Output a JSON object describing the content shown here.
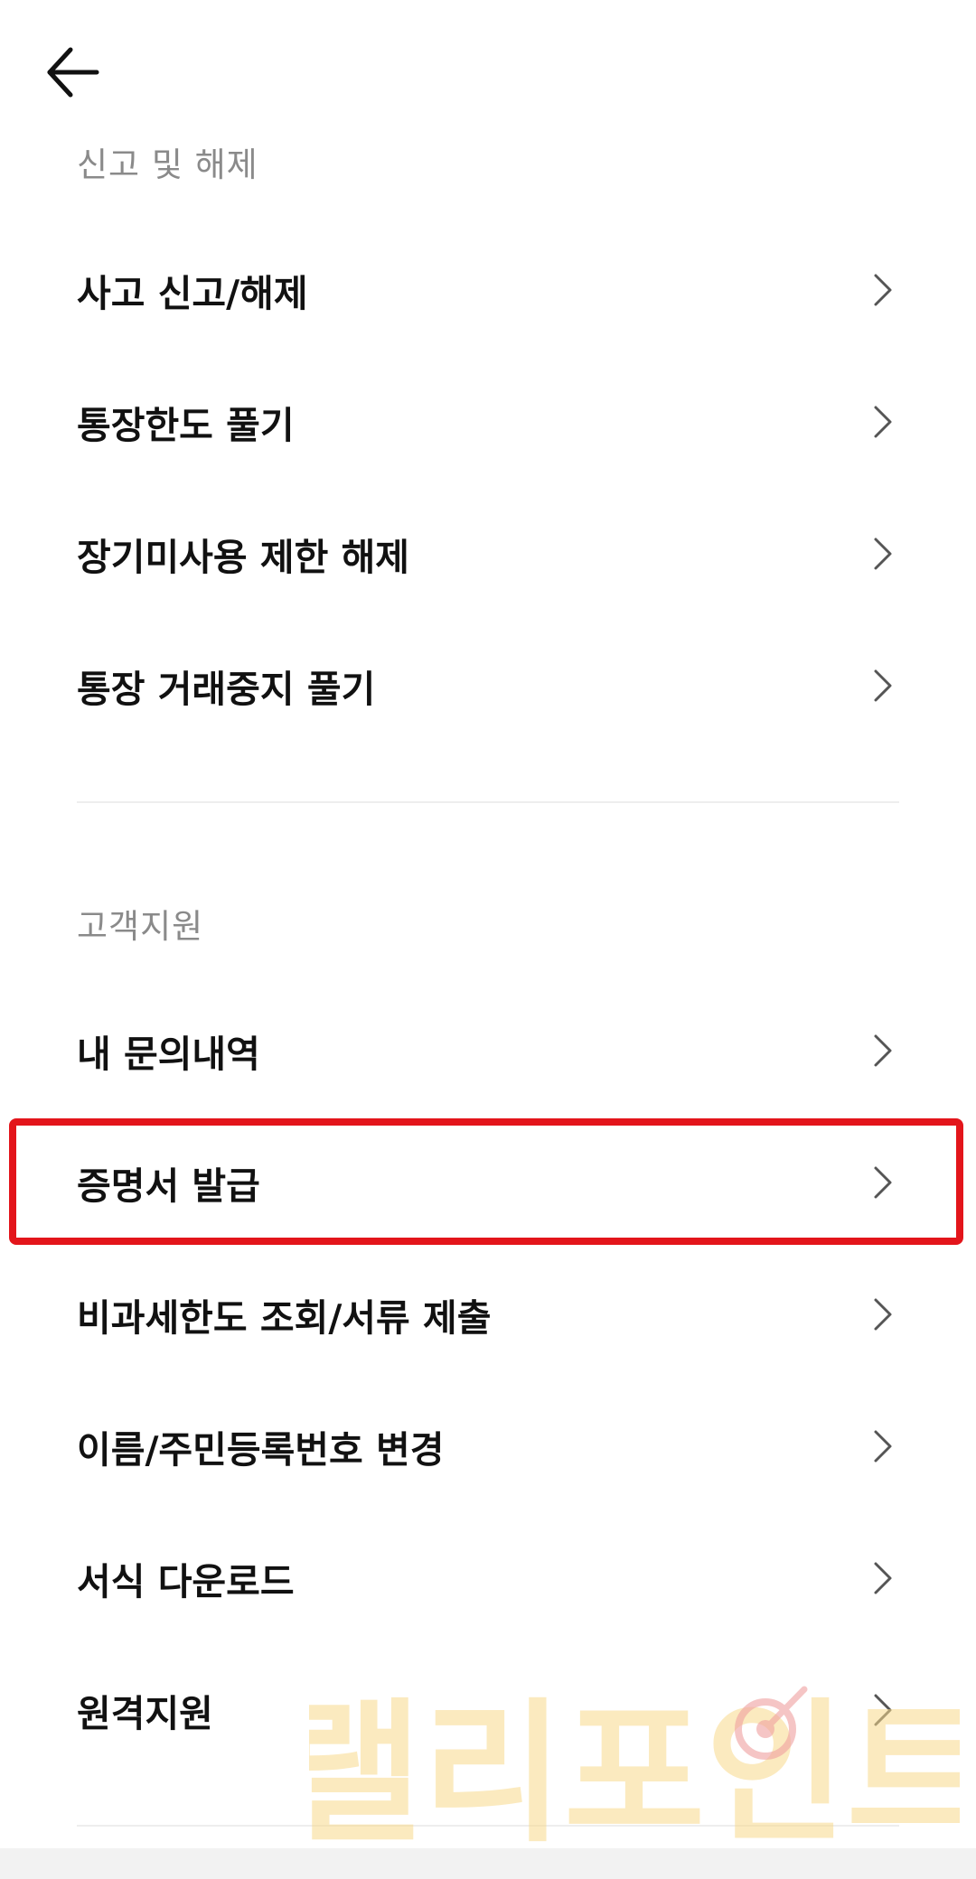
{
  "header": {
    "back_icon": "arrow-left-icon"
  },
  "sections": [
    {
      "title": "신고 및 해제",
      "items": [
        {
          "label": "사고 신고/해제"
        },
        {
          "label": "통장한도 풀기"
        },
        {
          "label": "장기미사용 제한 해제"
        },
        {
          "label": "통장 거래중지 풀기"
        }
      ]
    },
    {
      "title": "고객지원",
      "items": [
        {
          "label": "내 문의내역"
        },
        {
          "label": "증명서 발급",
          "highlighted": true
        },
        {
          "label": "비과세한도 조회/서류 제출"
        },
        {
          "label": "이름/주민등록번호 변경"
        },
        {
          "label": "서식 다운로드"
        },
        {
          "label": "원격지원"
        }
      ]
    }
  ],
  "watermark": {
    "text": "랠리포인트",
    "color": "#f7d98a"
  },
  "colors": {
    "highlight": "#e3151b",
    "section_header": "#8a8a8a",
    "chevron": "#555555"
  }
}
